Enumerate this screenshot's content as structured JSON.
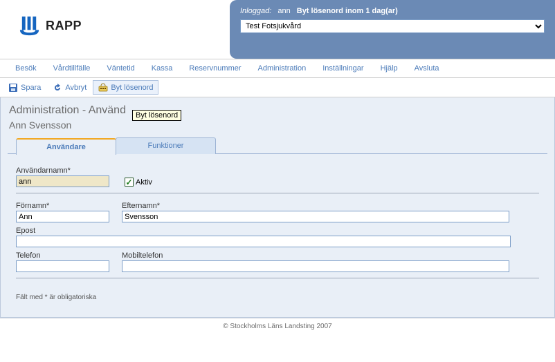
{
  "brand": {
    "name": "RAPP"
  },
  "header": {
    "logged_in_label": "Inloggad:",
    "username": "ann",
    "pw_warning": "Byt lösenord inom 1 dag(ar)",
    "org_selected": "Test Fotsjukvård"
  },
  "menu": {
    "items": [
      "Besök",
      "Vårdtillfälle",
      "Väntetid",
      "Kassa",
      "Reservnummer",
      "Administration",
      "Inställningar",
      "Hjälp",
      "Avsluta"
    ]
  },
  "toolbar": {
    "save": "Spara",
    "cancel": "Avbryt",
    "change_pw": "Byt lösenord"
  },
  "tooltip": "Byt lösenord",
  "page": {
    "title": "Administration - Använd",
    "subtitle": "Ann Svensson"
  },
  "tabs": {
    "users": "Användare",
    "functions": "Funktioner"
  },
  "form": {
    "username_label": "Användarnamn*",
    "username_value": "ann",
    "active_label": "Aktiv",
    "firstname_label": "Förnamn*",
    "firstname_value": "Ann",
    "lastname_label": "Efternamn*",
    "lastname_value": "Svensson",
    "email_label": "Epost",
    "email_value": "",
    "phone_label": "Telefon",
    "phone_value": "",
    "mobile_label": "Mobiltelefon",
    "mobile_value": "",
    "required_note": "Fält med * är obligatoriska"
  },
  "footer": "© Stockholms Läns Landsting 2007"
}
